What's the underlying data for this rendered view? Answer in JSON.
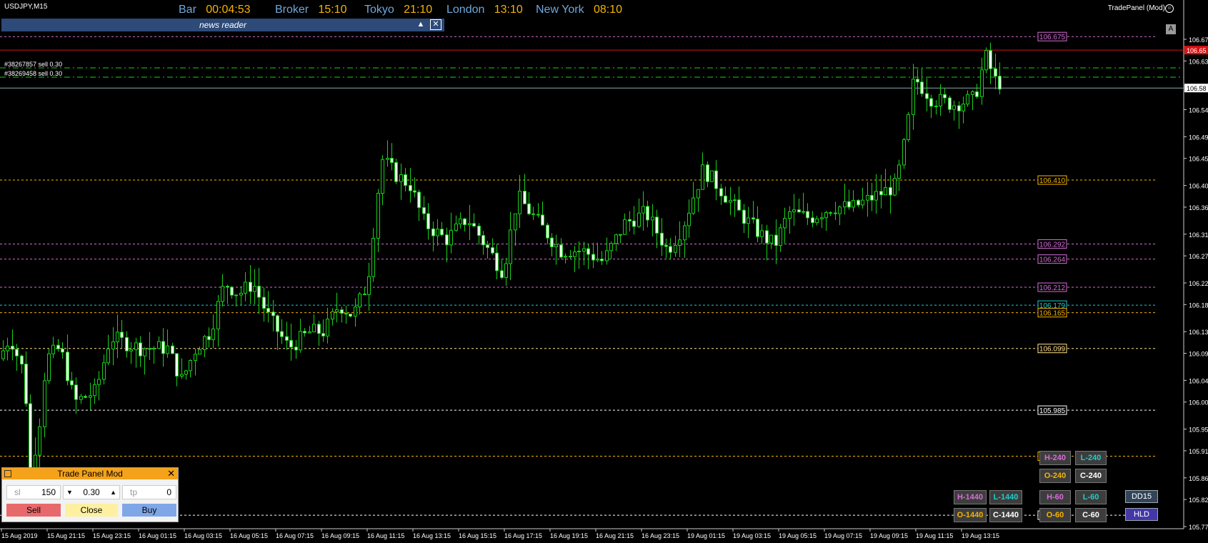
{
  "symbol": "USDJPY,M15",
  "clocks": [
    {
      "label": "Bar",
      "value": "00:04:53"
    },
    {
      "label": "Broker",
      "value": "15:10"
    },
    {
      "label": "Tokyo",
      "value": "21:10"
    },
    {
      "label": "London",
      "value": "13:10"
    },
    {
      "label": "New York",
      "value": "08:10"
    }
  ],
  "tradepanel_title": "TradePanel (Mod)",
  "news_reader": {
    "title": "news reader",
    "minimize": "▲",
    "close": "✕"
  },
  "auto_button": "A",
  "trades": [
    "#38267857 sell 0.30",
    "#38269458 sell 0.30"
  ],
  "price_axis": [
    "106.67",
    "106.63",
    "106.58",
    "106.54",
    "106.49",
    "106.45",
    "106.40",
    "106.36",
    "106.31",
    "106.27",
    "106.22",
    "106.18",
    "106.13",
    "106.09",
    "106.04",
    "106.00",
    "105.95",
    "105.91",
    "105.86",
    "105.82",
    "105.77"
  ],
  "current_price": "106.58",
  "red_price": "106.65",
  "time_axis": [
    "15 Aug 2019",
    "15 Aug 21:15",
    "15 Aug 23:15",
    "16 Aug 01:15",
    "16 Aug 03:15",
    "16 Aug 05:15",
    "16 Aug 07:15",
    "16 Aug 09:15",
    "16 Aug 11:15",
    "16 Aug 13:15",
    "16 Aug 15:15",
    "16 Aug 17:15",
    "16 Aug 19:15",
    "16 Aug 21:15",
    "16 Aug 23:15",
    "19 Aug 01:15",
    "19 Aug 03:15",
    "19 Aug 05:15",
    "19 Aug 07:15",
    "19 Aug 09:15",
    "19 Aug 11:15",
    "19 Aug 13:15"
  ],
  "levels": [
    {
      "price": "106.675",
      "color": "#d86cd8"
    },
    {
      "price": "106.410",
      "color": "#f5b400"
    },
    {
      "price": "106.292",
      "color": "#d86cd8"
    },
    {
      "price": "106.264",
      "color": "#d86cd8"
    },
    {
      "price": "106.212",
      "color": "#d86cd8"
    },
    {
      "price": "106.179",
      "color": "#22cccc"
    },
    {
      "price": "106.165",
      "color": "#f5b400"
    },
    {
      "price": "106.099",
      "color": "#ffe08a"
    },
    {
      "price": "105.985",
      "color": "#ffffff"
    },
    {
      "price": "105.900",
      "color": "#f5b400"
    },
    {
      "price": "105.791",
      "color": "#ffffff"
    }
  ],
  "trade_panel": {
    "title": "Trade Panel Mod",
    "sl_label": "sl",
    "sl_value": "150",
    "lots": "0.30",
    "tp_label": "tp",
    "tp_value": "0",
    "sell": "Sell",
    "close": "Close",
    "buy": "Buy"
  },
  "tf_buttons": {
    "h240": "H-240",
    "l240": "L-240",
    "o240": "O-240",
    "c240": "C-240",
    "h1440": "H-1440",
    "l1440": "L-1440",
    "o1440": "O-1440",
    "c1440": "C-1440",
    "h60": "H-60",
    "l60": "L-60",
    "o60": "O-60",
    "c60": "C-60",
    "dd15": "DD15",
    "hld": "HLD"
  }
}
